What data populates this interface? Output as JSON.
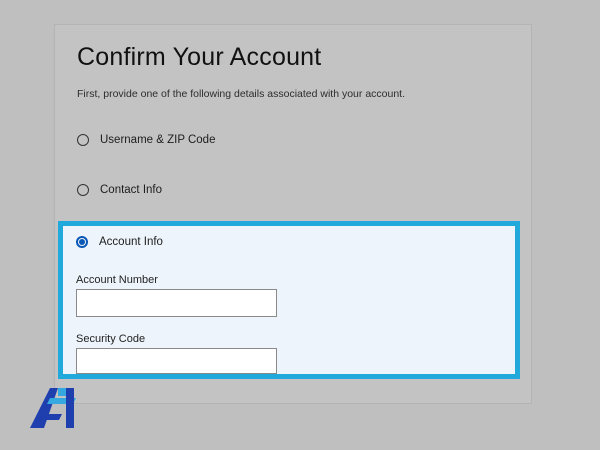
{
  "form": {
    "title": "Confirm Your Account",
    "subtitle": "First, provide one of the following details associated with your account.",
    "options": [
      {
        "label": "Username & ZIP Code",
        "selected": false
      },
      {
        "label": "Contact Info",
        "selected": false
      },
      {
        "label": "Account Info",
        "selected": true
      }
    ],
    "fields": {
      "account_number": {
        "label": "Account Number",
        "value": ""
      },
      "security_code": {
        "label": "Security Code",
        "value": ""
      }
    }
  },
  "colors": {
    "highlight_border": "#22a9dc",
    "radio_selected": "#0a58b5",
    "logo_blue": "#1f3fae",
    "logo_light_blue": "#35a8e0"
  },
  "icons": {
    "logo": "fa-monogram-logo"
  }
}
